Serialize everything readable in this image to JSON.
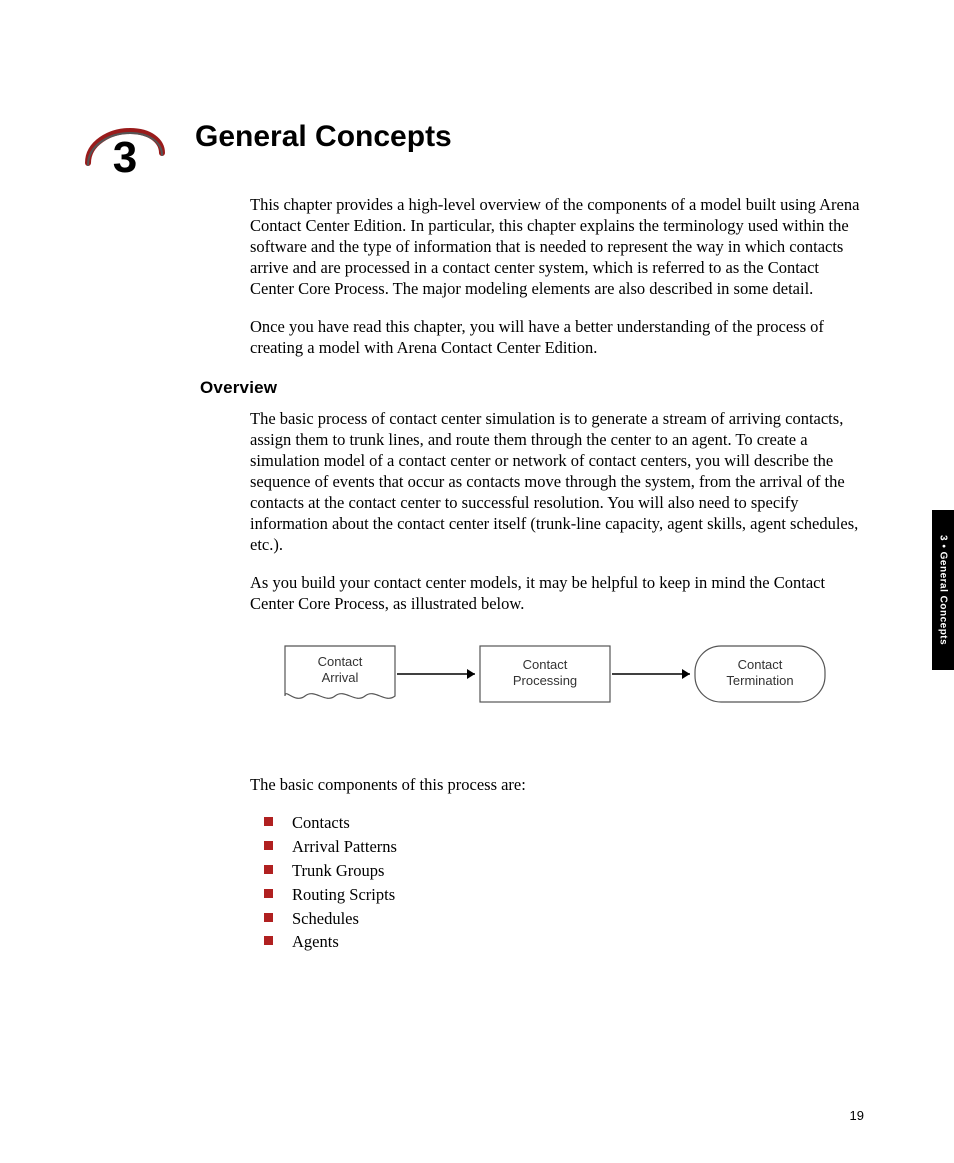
{
  "chapter": {
    "number": "3",
    "title": "General Concepts"
  },
  "intro": {
    "p1": "This chapter provides a high-level overview of the components of a model built using Arena Contact Center Edition. In particular, this chapter explains the terminology used within the software and the type of information that is needed to represent the way in which contacts arrive and are processed in a contact center system, which is referred to as the Contact Center Core Process. The major modeling elements are also described in some detail.",
    "p2": "Once you have read this chapter, you will have a better understanding of the process of creating a model with Arena Contact Center Edition."
  },
  "section": {
    "heading": "Overview",
    "p1": "The basic process of contact center simulation is to generate a stream of arriving contacts, assign them to trunk lines, and route them through the center to an agent. To create a simulation model of a contact center or network of contact centers, you will describe the sequence of events that occur as contacts move through the system, from the arrival of the contacts at the contact center to successful resolution. You will also need to specify information about the contact center itself (trunk-line capacity, agent skills, agent schedules, etc.).",
    "p2": "As you build your contact center models, it may be helpful to keep in mind the Contact Center Core Process, as illustrated below.",
    "components_intro": "The basic components of this process are:"
  },
  "diagram": {
    "box1_line1": "Contact",
    "box1_line2": "Arrival",
    "box2_line1": "Contact",
    "box2_line2": "Processing",
    "box3_line1": "Contact",
    "box3_line2": "Termination"
  },
  "bullets": {
    "b0": "Contacts",
    "b1": "Arrival Patterns",
    "b2": "Trunk Groups",
    "b3": "Routing Scripts",
    "b4": "Schedules",
    "b5": "Agents"
  },
  "side_tab": "3 • General Concepts",
  "page_number": "19"
}
